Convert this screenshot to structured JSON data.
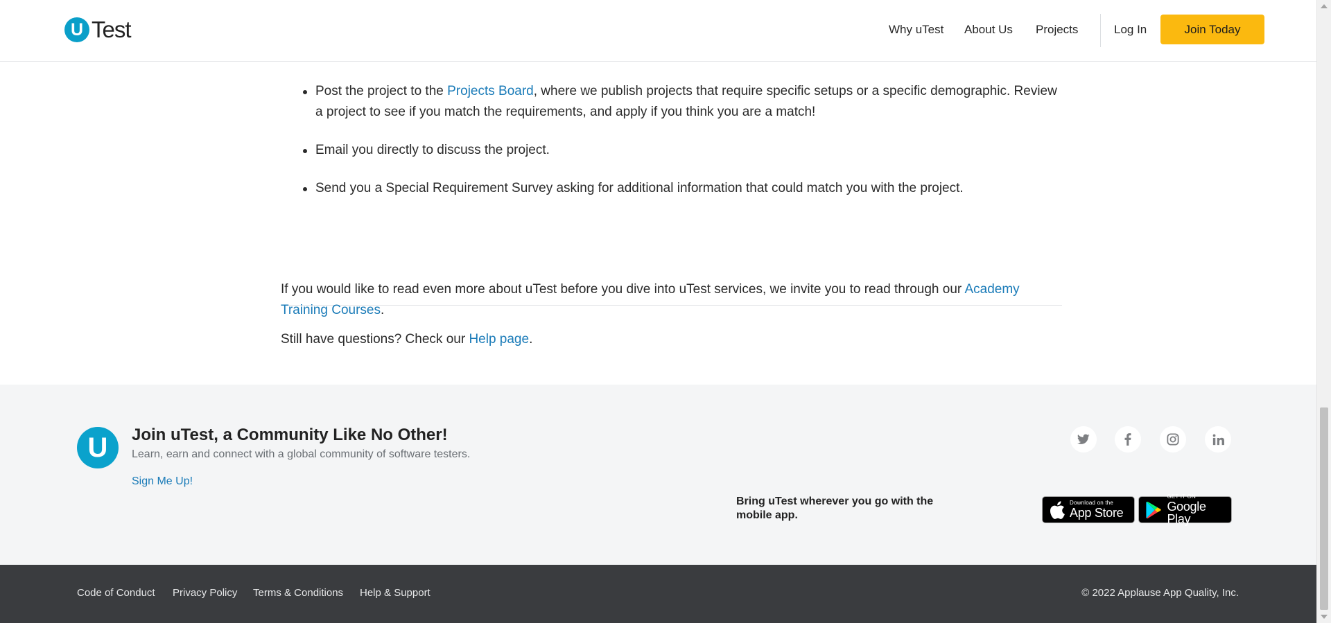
{
  "header": {
    "logo_letter": "U",
    "logo_word": "Test",
    "nav": {
      "why": "Why uTest",
      "about": "About Us",
      "projects": "Projects",
      "login": "Log In",
      "join": "Join Today"
    }
  },
  "content": {
    "bullets": [
      {
        "before": "Post the project to the ",
        "link": "Projects Board",
        "after": ", where we publish projects that require specific setups or a specific demographic. Review a project to see if you match the requirements, and apply if you think you are a match!"
      },
      {
        "text": "Email you directly to discuss the project."
      },
      {
        "text": "Send you a Special Requirement Survey asking for additional information that could match you with the project."
      }
    ],
    "read_more": {
      "before": "If you would like to read even more about uTest before you dive into uTest services, we invite you to read through our ",
      "link": "Academy Training Courses",
      "after": "."
    },
    "questions": {
      "before": "Still have questions? Check our ",
      "link": "Help page",
      "after": "."
    }
  },
  "footer": {
    "logo_letter": "U",
    "heading": "Join uTest, a Community Like No Other!",
    "tagline": "Learn, earn and connect with a global community of software testers.",
    "signup": "Sign Me Up!",
    "social_icons": [
      "twitter-icon",
      "facebook-icon",
      "instagram-icon",
      "linkedin-icon"
    ],
    "mobile_text": "Bring uTest wherever you go with the mobile app.",
    "app_store": {
      "small": "Download on the",
      "big": "App Store"
    },
    "google_play": {
      "small": "GET IT ON",
      "big": "Google Play"
    },
    "legal": {
      "conduct": "Code of Conduct",
      "privacy": "Privacy Policy",
      "terms": "Terms & Conditions",
      "help": "Help & Support"
    },
    "copyright": "© 2022 Applause App Quality, Inc."
  },
  "colors": {
    "brand": "#0a9fc9",
    "join_button": "#fbb90f",
    "link": "#1a7bb8",
    "footer_top_bg": "#f4f5f6",
    "footer_bottom_bg": "#3a3c3f"
  }
}
